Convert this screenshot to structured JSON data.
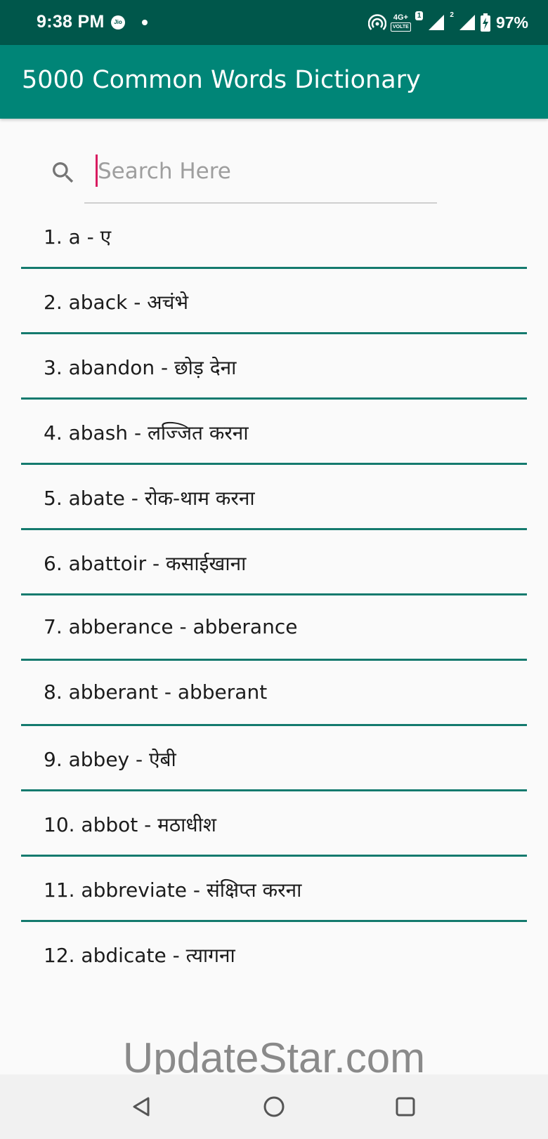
{
  "status_bar": {
    "time": "9:38 PM",
    "carrier_badge": "Jio",
    "network": "4G+",
    "volte": "VOLTE",
    "sim1": "1",
    "sim2": "2",
    "battery": "97%"
  },
  "app_bar": {
    "title": "5000 Common Words Dictionary"
  },
  "search": {
    "placeholder": "Search Here",
    "icon": "search-icon"
  },
  "words": [
    {
      "label": "1. a - ए"
    },
    {
      "label": "2. aback - अचंभे"
    },
    {
      "label": "3. abandon - छोड़ देना"
    },
    {
      "label": "4. abash - लज्जित करना"
    },
    {
      "label": "5. abate - रोक-थाम करना"
    },
    {
      "label": "6. abattoir - कसाईखाना"
    },
    {
      "label": "7. abberance - abberance"
    },
    {
      "label": "8. abberant - abberant"
    },
    {
      "label": "9. abbey - ऐबी"
    },
    {
      "label": "10. abbot - मठाधीश"
    },
    {
      "label": "11. abbreviate - संक्षिप्त करना"
    },
    {
      "label": "12. abdicate - त्यागना"
    }
  ],
  "watermark": "UpdateStar.com",
  "colors": {
    "status_bar": "#00574b",
    "app_bar": "#008577",
    "divider": "#147a6e",
    "caret": "#d81b60"
  }
}
